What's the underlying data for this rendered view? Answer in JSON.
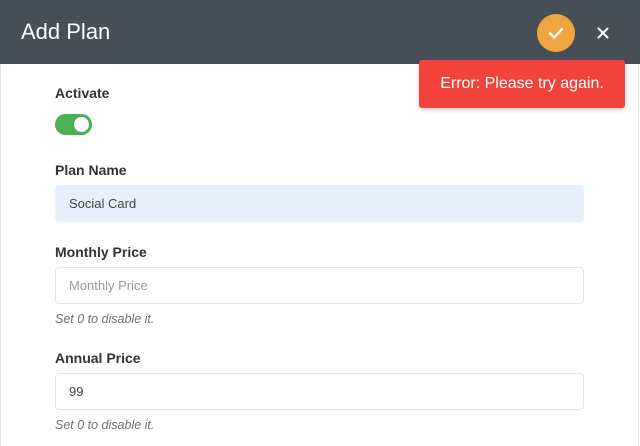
{
  "dialog": {
    "title": "Add Plan",
    "confirm_icon": "check-icon",
    "close_icon": "close-icon"
  },
  "toast": {
    "message": "Error: Please try again.",
    "color": "#f2433b"
  },
  "form": {
    "activate": {
      "label": "Activate",
      "checked": true,
      "color": "#4caf50"
    },
    "plan_name": {
      "label": "Plan Name",
      "value": "Social Card",
      "placeholder": ""
    },
    "monthly_price": {
      "label": "Monthly Price",
      "value": "",
      "placeholder": "Monthly Price",
      "hint": "Set 0 to disable it."
    },
    "annual_price": {
      "label": "Annual Price",
      "value": "99",
      "placeholder": "",
      "hint": "Set 0 to disable it."
    }
  },
  "colors": {
    "header": "#474f57",
    "accent": "#f0a640"
  }
}
